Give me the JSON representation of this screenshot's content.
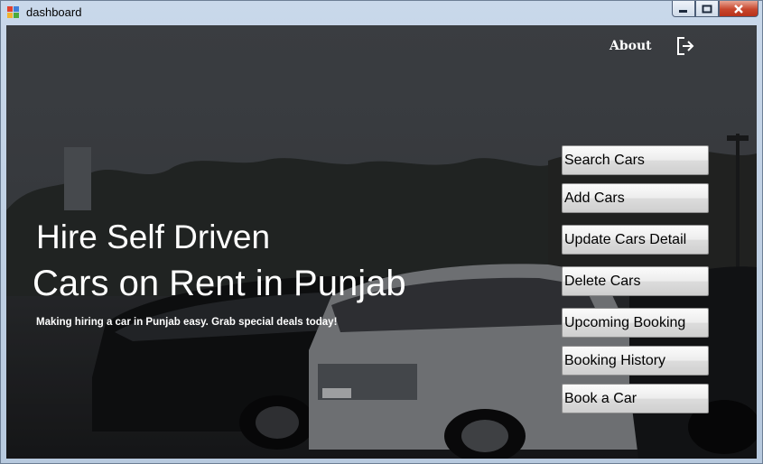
{
  "window": {
    "title": "dashboard"
  },
  "header": {
    "about_label": "About"
  },
  "hero": {
    "headline_line1": "Hire Self Driven",
    "headline_line2": "Cars on Rent in Punjab",
    "tagline": "Making hiring a car in Punjab easy. Grab special deals today!"
  },
  "menu": {
    "search_cars": "Search Cars",
    "add_cars": "Add Cars",
    "update_cars_detail": "Update Cars Detail",
    "delete_cars": "Delete Cars",
    "upcoming_booking": "Upcoming Booking",
    "booking_history": "Booking History",
    "book_a_car": "Book a Car"
  },
  "colors": {
    "overlay_text": "#ffffff",
    "close_button": "#c7462d",
    "background_dark": "#333436"
  }
}
